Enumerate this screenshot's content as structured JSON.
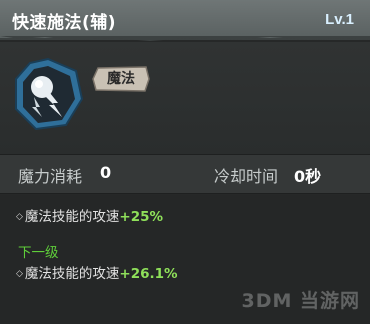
{
  "header": {
    "title": "快速施法(辅)",
    "level": "Lv.1"
  },
  "skill": {
    "icon": "magic-orb-icon",
    "tag": "魔法",
    "accent_color": "#2f6f9a"
  },
  "stats": {
    "mana_label": "魔力消耗",
    "mana_value": "0",
    "cooldown_label": "冷却时间",
    "cooldown_value": "0秒"
  },
  "current": {
    "text": "魔法技能的攻速",
    "bonus": "+25%"
  },
  "next_level": {
    "label": "下一级",
    "text": "魔法技能的攻速",
    "bonus": "+26.1%"
  },
  "watermark": "3DM 当游网",
  "colors": {
    "bonus_green": "#8fe05a",
    "next_green": "#5fcf3a"
  }
}
